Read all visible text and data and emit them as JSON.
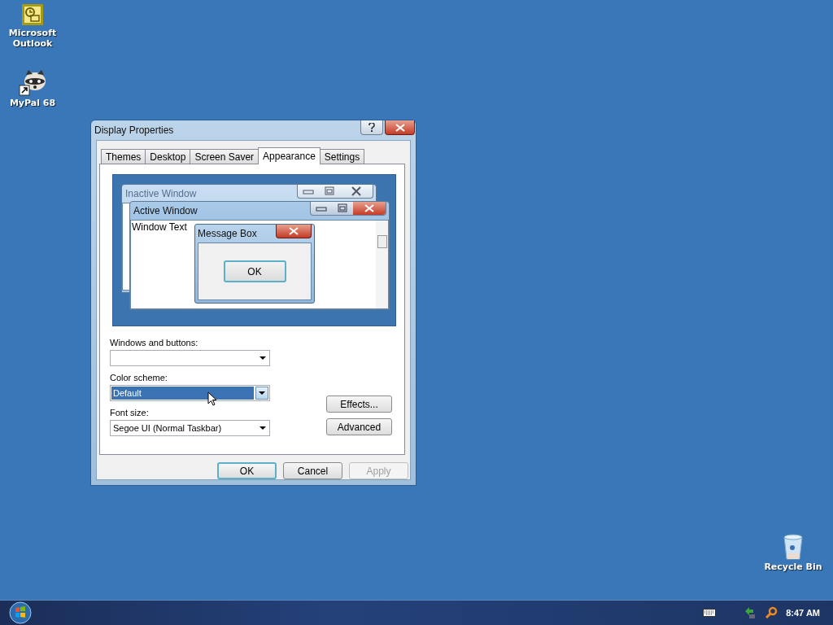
{
  "desktop_icons": [
    {
      "label": "Microsoft Outlook",
      "kind": "outlook"
    },
    {
      "label": "MyPal 68",
      "kind": "mypal"
    },
    {
      "label": "Recycle Bin",
      "kind": "bin"
    }
  ],
  "dialog": {
    "title": "Display Properties",
    "tabs": [
      {
        "label": "Themes",
        "selected": false
      },
      {
        "label": "Desktop",
        "selected": false
      },
      {
        "label": "Screen Saver",
        "selected": false
      },
      {
        "label": "Appearance",
        "selected": true
      },
      {
        "label": "Settings",
        "selected": false
      }
    ],
    "preview": {
      "inactive_title": "Inactive Window",
      "active_title": "Active Window",
      "window_text": "Window Text",
      "message_box_title": "Message Box",
      "message_box_button": "OK"
    },
    "fields": [
      {
        "label": "Windows and buttons:",
        "highlighted": false
      },
      {
        "label": "Color scheme:",
        "value": "Default",
        "highlighted": true
      },
      {
        "label": "Font size:",
        "value": "Segoe UI (Normal Taskbar)",
        "highlighted": false
      }
    ],
    "side_buttons": [
      "Effects...",
      "Advanced"
    ],
    "buttons": [
      {
        "label": "OK",
        "disabled": false,
        "default": true
      },
      {
        "label": "Cancel",
        "disabled": false,
        "default": false
      },
      {
        "label": "Apply",
        "disabled": true,
        "default": false
      }
    ]
  },
  "taskbar": {
    "clock": "8:47 AM"
  }
}
